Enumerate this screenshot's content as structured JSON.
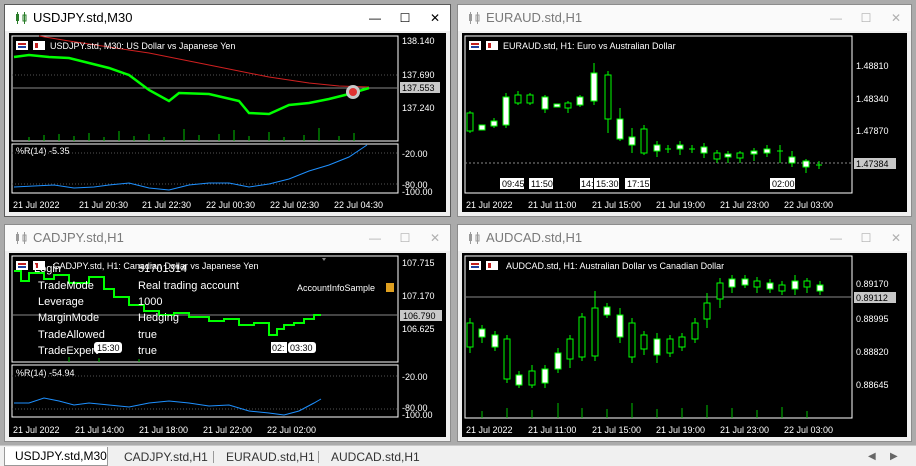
{
  "windows": {
    "usdjpy": {
      "title": "USDJPY.std,M30",
      "chart_label": "USDJPY.std, M30:  US Dollar vs Japanese Yen",
      "price_ticks": [
        "138.140",
        "137.690",
        "137.240"
      ],
      "current_price": "137.553",
      "indicator_label": "%R(14) -5.35",
      "indicator_ticks": [
        "-20.00",
        "-80.00",
        "-100.00"
      ],
      "time_ticks": [
        "21 Jul 2022",
        "21 Jul 20:30",
        "21 Jul 22:30",
        "22 Jul 00:30",
        "22 Jul 02:30",
        "22 Jul 04:30"
      ]
    },
    "euraud": {
      "title": "EURAUD.std,H1",
      "chart_label": "EURAUD.std, H1:  Euro vs Australian Dollar",
      "price_ticks": [
        "1.48810",
        "1.48340",
        "1.47870"
      ],
      "current_price": "1.47384",
      "time_ticks": [
        "21 Jul 2022",
        "21 Jul 11:00",
        "21 Jul 15:00",
        "21 Jul 19:00",
        "21 Jul 23:00",
        "22 Jul 03:00"
      ],
      "session_labels": [
        "09:45",
        "11:50",
        "14:",
        "15:30",
        "17:15",
        "02:00"
      ]
    },
    "cadjpy": {
      "title": "CADJPY.std,H1",
      "chart_label": "CADJPY.std, H1:  Canadian Dollar vs Japanese Yen",
      "price_ticks": [
        "107.715",
        "107.170",
        "106.625"
      ],
      "current_price": "106.790",
      "indicator_label": "%R(14) -54.94",
      "indicator_ticks": [
        "-20.00",
        "-80.00",
        "-100.00"
      ],
      "time_ticks": [
        "21 Jul 2022",
        "21 Jul 14:00",
        "21 Jul 18:00",
        "21 Jul 22:00",
        "22 Jul 02:00"
      ],
      "session_labels": [
        "15:30",
        "02:",
        "03:30"
      ],
      "expert_name": "AccountInfoSample",
      "account_info": [
        {
          "key": "Login",
          "value": "51701314"
        },
        {
          "key": "TradeMode",
          "value": "Real trading account"
        },
        {
          "key": "Leverage",
          "value": "1000"
        },
        {
          "key": "MarginMode",
          "value": "Hedging"
        },
        {
          "key": "TradeAllowed",
          "value": "true"
        },
        {
          "key": "TradeExpert",
          "value": "true"
        }
      ]
    },
    "audcad": {
      "title": "AUDCAD.std,H1",
      "chart_label": "AUDCAD.std, H1:  Australian Dollar vs Canadian Dollar",
      "price_ticks": [
        "0.89170",
        "0.88995",
        "0.88820",
        "0.88645"
      ],
      "current_price": "0.89112",
      "time_ticks": [
        "21 Jul 2022",
        "21 Jul 11:00",
        "21 Jul 15:00",
        "21 Jul 19:00",
        "21 Jul 23:00",
        "22 Jul 03:00"
      ]
    }
  },
  "tabs": [
    "USDJPY.std,M30",
    "CADJPY.std,H1",
    "EURAUD.std,H1",
    "AUDCAD.std,H1"
  ],
  "colors": {
    "chart_bg": "#000000",
    "bull": "#00ff00",
    "line": "#00ff00",
    "ma": "#ff0000",
    "wpr": "#1e90ff",
    "grid": "#606060"
  }
}
